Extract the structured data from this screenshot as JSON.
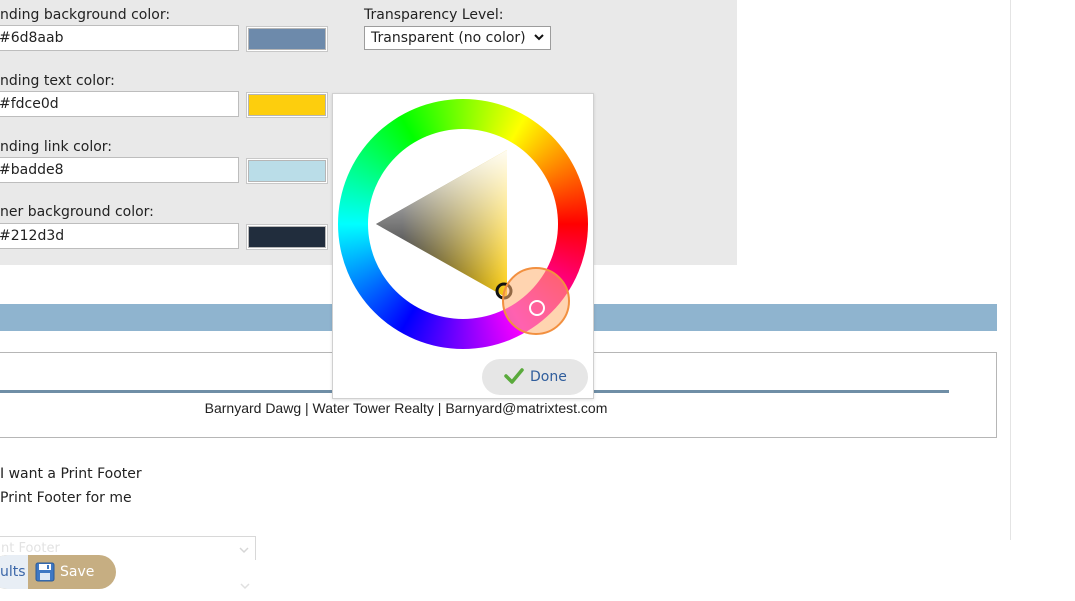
{
  "colors": {
    "heading_background": "#6d8aab",
    "heading_text": "#fdce0d",
    "heading_link": "#badde8",
    "banner_background": "#212d3d",
    "blue_bar": "#8fb4cf",
    "save_button": "#c6ae82",
    "link_text": "#3b66a8"
  },
  "fields": [
    {
      "label": "nding background color:",
      "value": "#6d8aab"
    },
    {
      "label": "nding text color:",
      "value": "#fdce0d"
    },
    {
      "label": "nding link color:",
      "value": "#badde8"
    },
    {
      "label": "ner background color:",
      "value": "#212d3d"
    }
  ],
  "transparency": {
    "label": "Transparency Level:",
    "selected": "Transparent (no color)"
  },
  "footer": {
    "text": "Barnyard Dawg | Water Tower Realty | Barnyard@matrixtest.com"
  },
  "options": {
    "option1": "I want a Print Footer",
    "option2": "Print Footer for me"
  },
  "ghost_select_text": "nt Footer",
  "buttons": {
    "results_partial": "ults",
    "save": "Save",
    "done": "Done"
  },
  "icons": {
    "save": "floppy-disk-icon",
    "done": "checkmark-icon",
    "select_arrow": "chevron-down-icon"
  }
}
